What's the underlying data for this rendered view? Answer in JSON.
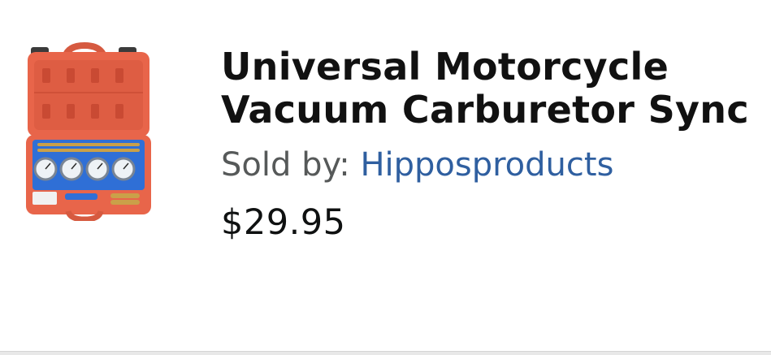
{
  "product": {
    "title_line1": "Universal Motorcycle",
    "title_line2": "Vacuum Carburetor Sync",
    "seller_label": "Sold by:",
    "seller_name": "Hipposproducts",
    "price": "$29.95",
    "image_icon": "carburetor-sync-kit-case"
  },
  "colors": {
    "case_orange": "#e8654a",
    "insert_blue": "#2f6fd6",
    "seller_link": "#2f5fa0",
    "seller_label": "#565959",
    "price_text": "#0f1111"
  }
}
